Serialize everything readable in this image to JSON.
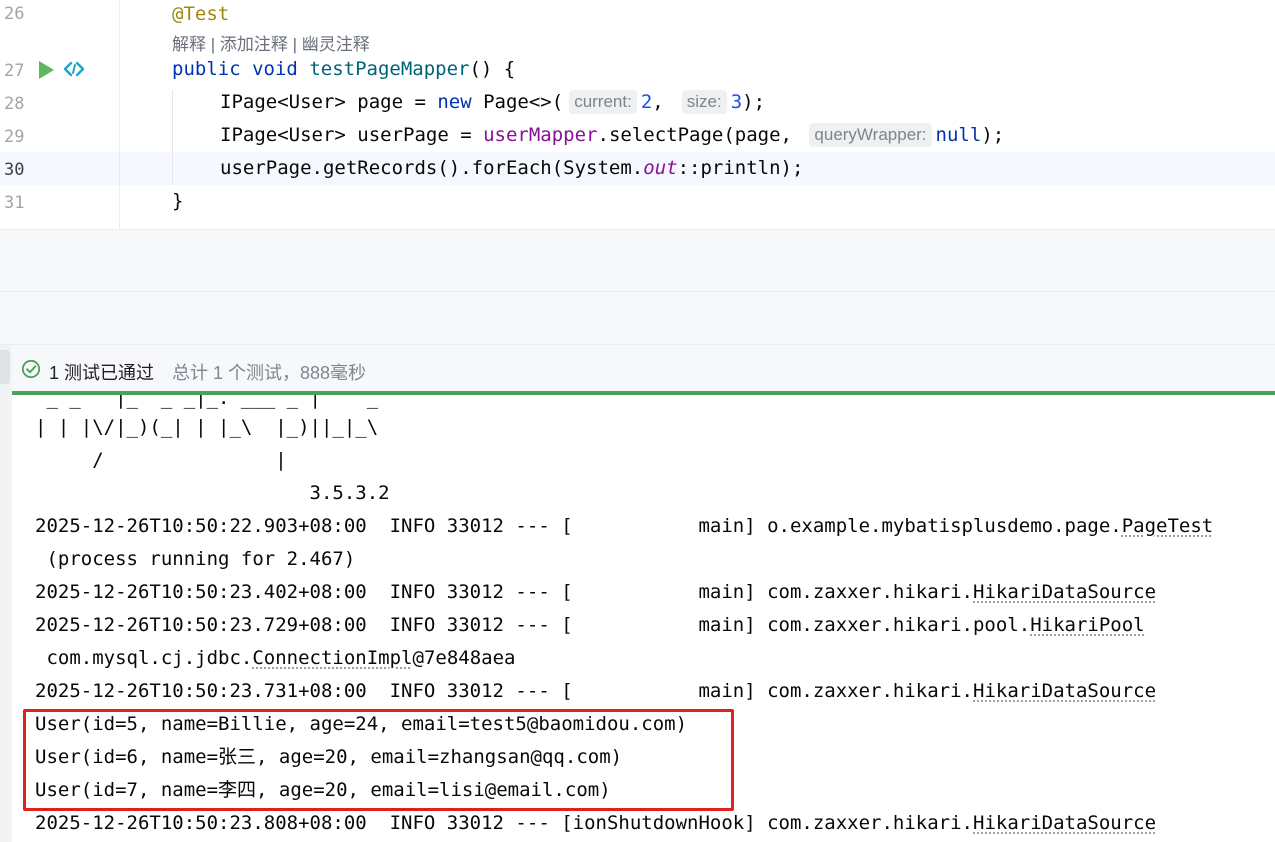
{
  "editor": {
    "line_numbers": [
      "26",
      "27",
      "28",
      "29",
      "30",
      "31"
    ],
    "annotation": "@Test",
    "codelens": "解释 | 添加注释 | 幽灵注释",
    "line27": {
      "kw1": "public",
      "kw2": "void",
      "method": "testPageMapper",
      "rest": "() {"
    },
    "line28": {
      "start": "IPage<User> page = ",
      "kw": "new",
      "mid": " Page<>(",
      "hint1": "current:",
      "val1": "2",
      "sep": ",",
      "hint2": "size:",
      "val2": "3",
      "end": ");"
    },
    "line29": {
      "start": "IPage<User> userPage = ",
      "field": "userMapper",
      "mid": ".selectPage(page, ",
      "hint": "queryWrapper:",
      "kw": "null",
      "end": ");"
    },
    "line30": {
      "start": "userPage.getRecords().forEach(System.",
      "field": "out",
      "end": "::println);"
    },
    "line31": "}"
  },
  "tests": {
    "status": "1 测试已通过",
    "summary": "总计 1 个测试，888毫秒"
  },
  "console": {
    "banner_top": " _ _   |_  _ _|_. ___ _ |    _",
    "banner_mid": "| | |\\/|_)(_| | |_\\  |_)||_|_\\",
    "banner_low": "     /               |",
    "banner_version": "                        3.5.3.2",
    "log1_prefix": "2025-12-26T10:50:22.903+08:00  INFO 33012 --- [           main] o.example.mybatisplusdemo.page.",
    "log1_class": "PageTest",
    "log1_cont": " (process running for 2.467)",
    "log2_prefix": "2025-12-26T10:50:23.402+08:00  INFO 33012 --- [           main] com.zaxxer.hikari.",
    "log2_class": "HikariDataSource",
    "log3_prefix": "2025-12-26T10:50:23.729+08:00  INFO 33012 --- [           main] com.zaxxer.hikari.pool.",
    "log3_class": "HikariPool",
    "log3_cont_prefix": " com.mysql.cj.jdbc.",
    "log3_cont_class": "ConnectionImpl",
    "log3_cont_suffix": "@7e848aea",
    "log4_prefix": "2025-12-26T10:50:23.731+08:00  INFO 33012 --- [           main] com.zaxxer.hikari.",
    "log4_class": "HikariDataSource",
    "user1": "User(id=5, name=Billie, age=24, email=test5@baomidou.com)",
    "user2": "User(id=6, name=张三, age=20, email=zhangsan@qq.com)",
    "user3": "User(id=7, name=李四, age=20, email=lisi@email.com)",
    "log5_prefix": "2025-12-26T10:50:23.808+08:00  INFO 33012 --- [ionShutdownHook] com.zaxxer.hikari.",
    "log5_class": "HikariDataSource"
  },
  "colors": {
    "pass_green": "#4d9f5a",
    "highlight_red": "#e0201b",
    "keyword_blue": "#0033b3",
    "field_purple": "#871094"
  },
  "icons": [
    "run-test-icon",
    "link-icon",
    "test-passed-icon"
  ]
}
